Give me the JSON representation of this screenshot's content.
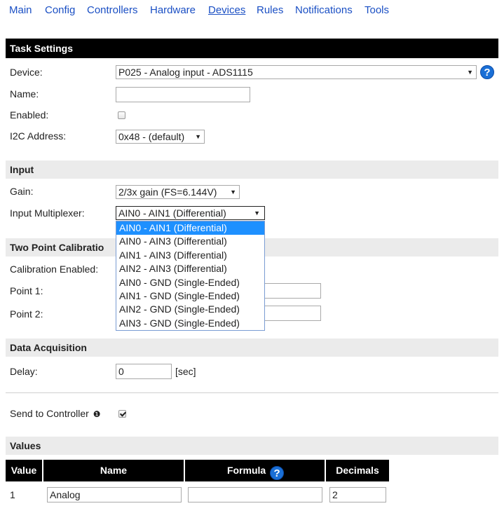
{
  "nav": {
    "items": [
      "Main",
      "Config",
      "Controllers",
      "Hardware",
      "Devices",
      "Rules",
      "Notifications",
      "Tools"
    ],
    "active": "Devices"
  },
  "task_settings": {
    "header": "Task Settings",
    "device_label": "Device:",
    "device_value": "P025 - Analog input - ADS1115",
    "name_label": "Name:",
    "name_value": "",
    "enabled_label": "Enabled:",
    "enabled": false,
    "i2c_label": "I2C Address:",
    "i2c_value": "0x48 - (default)"
  },
  "input": {
    "header": "Input",
    "gain_label": "Gain:",
    "gain_value": "2/3x gain (FS=6.144V)",
    "mux_label": "Input Multiplexer:",
    "mux_value": "AIN0 - AIN1 (Differential)",
    "mux_options": [
      "AIN0 - AIN1 (Differential)",
      "AIN0 - AIN3 (Differential)",
      "AIN1 - AIN3 (Differential)",
      "AIN2 - AIN3 (Differential)",
      "AIN0 - GND (Single-Ended)",
      "AIN1 - GND (Single-Ended)",
      "AIN2 - GND (Single-Ended)",
      "AIN3 - GND (Single-Ended)"
    ],
    "mux_selected_index": 0
  },
  "calibration": {
    "header": "Two Point Calibratio",
    "enabled_label": "Calibration Enabled:",
    "point1_label": "Point 1:",
    "point2_label": "Point 2:"
  },
  "acquisition": {
    "header": "Data Acquisition",
    "delay_label": "Delay:",
    "delay_value": "0",
    "delay_unit": "[sec]"
  },
  "send": {
    "label": "Send to Controller",
    "info_icon": "❶",
    "checked": true
  },
  "values": {
    "header": "Values",
    "columns": [
      "Value",
      "Name",
      "Formula",
      "Decimals"
    ],
    "rows": [
      {
        "index": "1",
        "name": "Analog",
        "formula": "",
        "decimals": "2"
      }
    ]
  },
  "icons": {
    "help": "?"
  },
  "colors": {
    "link": "#1a4fc4",
    "help_icon": "#1a6fd6",
    "selected_option": "#1e90ff"
  }
}
